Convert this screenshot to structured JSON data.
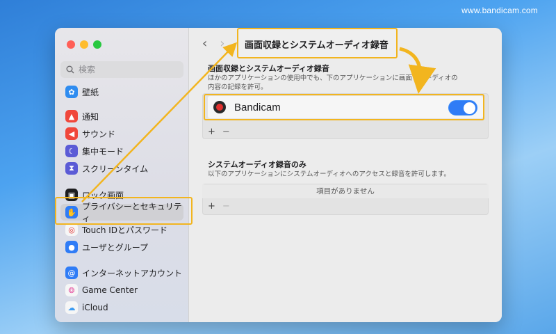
{
  "watermark": "www.bandicam.com",
  "sidebar": {
    "search_placeholder": "検索",
    "items": [
      {
        "label": "壁紙",
        "icon": "wallpaper-icon",
        "color": "#2f8cf0"
      },
      {
        "label": "通知",
        "icon": "bell-icon",
        "color": "#f0473b"
      },
      {
        "label": "サウンド",
        "icon": "speaker-icon",
        "color": "#f0473b"
      },
      {
        "label": "集中モード",
        "icon": "moon-icon",
        "color": "#5b5bd6"
      },
      {
        "label": "スクリーンタイム",
        "icon": "hourglass-icon",
        "color": "#5b5bd6"
      },
      {
        "label": "ロック画面",
        "icon": "lock-icon",
        "color": "#1d1d1f"
      },
      {
        "label": "プライバシーとセキュリティ",
        "icon": "hand-icon",
        "color": "#2f7cf6"
      },
      {
        "label": "Touch IDとパスワード",
        "icon": "fingerprint-icon",
        "color": "#f6f6f6"
      },
      {
        "label": "ユーザとグループ",
        "icon": "users-icon",
        "color": "#2f7cf6"
      },
      {
        "label": "インターネットアカウント",
        "icon": "at-icon",
        "color": "#2f7cf6"
      },
      {
        "label": "Game Center",
        "icon": "gamecenter-icon",
        "color": "#f6f6f6"
      },
      {
        "label": "iCloud",
        "icon": "cloud-icon",
        "color": "#f6f6f6"
      }
    ]
  },
  "content": {
    "nav_back": "‹",
    "nav_forward": "›",
    "title": "画面収録とシステムオーディオ録音",
    "section1": {
      "title": "画面収録とシステムオーディオ録音",
      "desc": "ほかのアプリケーションの使用中でも、下のアプリケーションに画面とオーディオの内容の記録を許可。",
      "app_name": "Bandicam",
      "toggle_on": true
    },
    "section2": {
      "title": "システムオーディオ録音のみ",
      "desc": "以下のアプリケーションにシステムオーディオへのアクセスと録音を許可します。",
      "empty_text": "項目がありません"
    },
    "plus": "+",
    "minus": "−"
  },
  "colors": {
    "accent": "#2f7cf6",
    "highlight": "#f2b51f"
  }
}
